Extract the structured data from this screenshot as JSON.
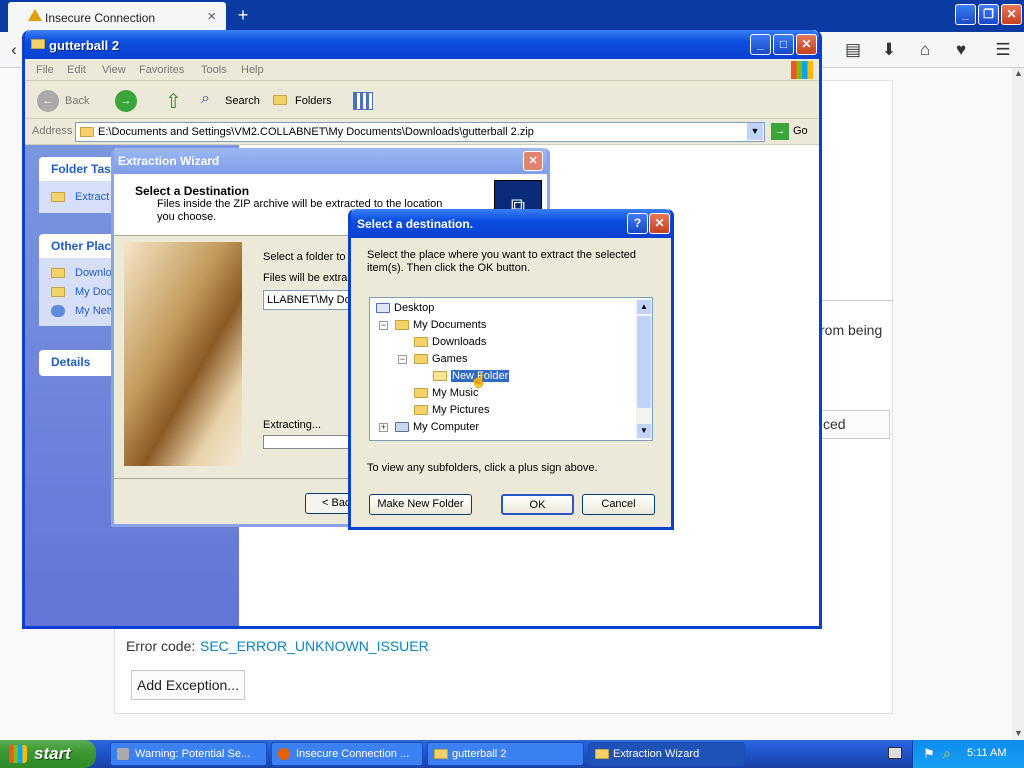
{
  "browser": {
    "tab_title": "Insecure Connection",
    "close_tab": "×",
    "new_tab": "+",
    "window_controls": [
      "minimize",
      "restore",
      "close"
    ]
  },
  "error_page": {
    "partial_text": "rom being",
    "advanced_button": "ced",
    "error_code_label": "Error code:",
    "error_code": "SEC_ERROR_UNKNOWN_ISSUER",
    "add_exception_button": "Add Exception..."
  },
  "explorer": {
    "title": "gutterball 2",
    "menu": [
      "File",
      "Edit",
      "View",
      "Favorites",
      "Tools",
      "Help"
    ],
    "toolbar": {
      "back": "Back",
      "search": "Search",
      "folders": "Folders"
    },
    "address_label": "Address",
    "address_value": "E:\\Documents and Settings\\VM2.COLLABNET\\My Documents\\Downloads\\gutterball 2.zip",
    "go_label": "Go",
    "folder_tasks": {
      "title": "Folder Tas",
      "items": [
        "Extract"
      ]
    },
    "other_places": {
      "title": "Other Plac",
      "items": [
        "Downlo",
        "My Doc",
        "My Netw"
      ]
    },
    "details": {
      "title": "Details"
    }
  },
  "wizard": {
    "title": "Extraction Wizard",
    "heading": "Select a Destination",
    "subheading": "Files inside the ZIP archive will be extracted to the location you choose.",
    "select_label": "Select a folder to e",
    "files_label": "Files will be extract",
    "path_value": "LLABNET\\My Do",
    "extracting_label": "Extracting...",
    "back_button": "< Bac"
  },
  "dialog": {
    "title": "Select a destination.",
    "help": "?",
    "close": "✕",
    "instructions": "Select the place where you want to extract the selected item(s).  Then click the OK button.",
    "tree": [
      {
        "label": "Desktop",
        "level": 0,
        "expander": ""
      },
      {
        "label": "My Documents",
        "level": 1,
        "expander": "−"
      },
      {
        "label": "Downloads",
        "level": 2,
        "expander": ""
      },
      {
        "label": "Games",
        "level": 2,
        "expander": "−"
      },
      {
        "label": "New Folder",
        "level": 3,
        "expander": "",
        "selected": true
      },
      {
        "label": "My Music",
        "level": 2,
        "expander": ""
      },
      {
        "label": "My Pictures",
        "level": 2,
        "expander": ""
      },
      {
        "label": "My Computer",
        "level": 1,
        "expander": "+"
      }
    ],
    "hint": "To view any subfolders, click a plus sign above.",
    "make_folder_button": "Make New Folder",
    "ok_button": "OK",
    "cancel_button": "Cancel"
  },
  "taskbar": {
    "start": "start",
    "items": [
      "Warning: Potential Se...",
      "Insecure Connection ...",
      "gutterball 2",
      "Extraction Wizard"
    ],
    "active_index": 3,
    "clock": "5:11 AM"
  },
  "colors": {
    "xp_blue": "#0a3fd0",
    "taskbar": "#245edb",
    "start_green": "#3c9a32",
    "link": "#0a84c4"
  }
}
